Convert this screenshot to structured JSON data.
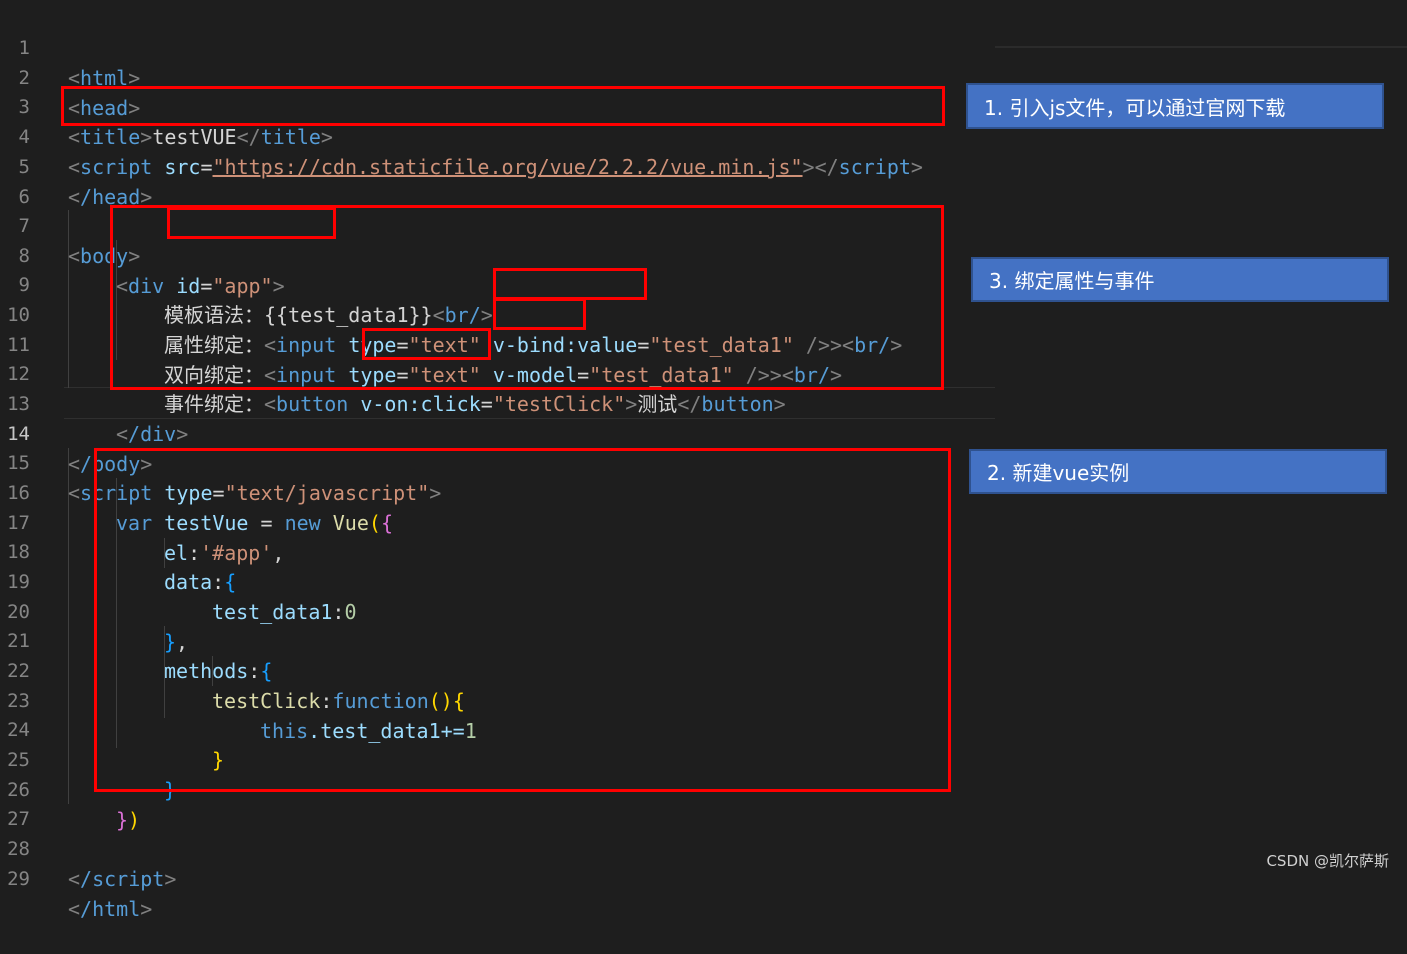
{
  "lines": [
    {
      "n": "1"
    },
    {
      "n": "2"
    },
    {
      "n": "3"
    },
    {
      "n": "4"
    },
    {
      "n": "5"
    },
    {
      "n": "6"
    },
    {
      "n": "7"
    },
    {
      "n": "8"
    },
    {
      "n": "9"
    },
    {
      "n": "10"
    },
    {
      "n": "11"
    },
    {
      "n": "12"
    },
    {
      "n": "13"
    },
    {
      "n": "14"
    },
    {
      "n": "15"
    },
    {
      "n": "16"
    },
    {
      "n": "17"
    },
    {
      "n": "18"
    },
    {
      "n": "19"
    },
    {
      "n": "20"
    },
    {
      "n": "21"
    },
    {
      "n": "22"
    },
    {
      "n": "23"
    },
    {
      "n": "24"
    },
    {
      "n": "25"
    },
    {
      "n": "26"
    },
    {
      "n": "27"
    },
    {
      "n": "28"
    },
    {
      "n": "29"
    }
  ],
  "code": {
    "l1": {
      "tag": "html"
    },
    "l2": {
      "tag": "head"
    },
    "l3": {
      "tag": "title",
      "text": "testVUE",
      "close": "title"
    },
    "l4": {
      "tag": "script",
      "attr": "src",
      "eq": "=",
      "val": "\"https://cdn.staticfile.org/vue/2.2.2/vue.min.js\"",
      "close": "script"
    },
    "l5": {
      "tag": "/head"
    },
    "l7": {
      "tag": "body"
    },
    "l8": {
      "tag": "div",
      "attr": "id",
      "eq": "=",
      "val": "\"app\""
    },
    "l9": {
      "label": "模板语法：",
      "expr": "{{test_data1}}",
      "br": "br/"
    },
    "l10": {
      "label": "属性绑定：",
      "tag": "input",
      "attr1": "type",
      "val1": "\"text\"",
      "attr2": "v-bind:value",
      "val2": "\"test_data1\"",
      "end": " />",
      "br": "br/"
    },
    "l11": {
      "label": "双向绑定：",
      "tag": "input",
      "attr1": "type",
      "val1": "\"text\"",
      "attr2": "v-model",
      "val2": "\"test_data1\"",
      "end": " />",
      "br": "br/"
    },
    "l12": {
      "label": "事件绑定：",
      "tag": "button",
      "attr": "v-on:click",
      "val": "\"testClick\"",
      "text": "测试",
      "close": "button"
    },
    "l13": {
      "tag": "/div"
    },
    "l14": {
      "tag": "/body"
    },
    "l15": {
      "tag": "script",
      "attr": "type",
      "val": "\"text/javascript\""
    },
    "l16": {
      "kw": "var",
      "name": "testVue",
      "op": " = ",
      "kw2": "new",
      "cls": "Vue"
    },
    "l17": {
      "key": "el",
      "val": "'#app'"
    },
    "l18": {
      "key": "data"
    },
    "l19": {
      "key": "test_data1",
      "val": "0"
    },
    "l21": {
      "key": "methods"
    },
    "l22": {
      "key": "testClick",
      "kw": "function"
    },
    "l23": {
      "kw": "this",
      "rest": ".test_data1+=",
      "num": "1"
    },
    "l28": {
      "tag": "/script"
    },
    "l29": {
      "tag": "/html"
    }
  },
  "callouts": {
    "c1": "1. 引入js文件，可以通过官网下载",
    "c2": "2. 新建vue实例",
    "c3": "3. 绑定属性与事件"
  },
  "watermark": "CSDN @凯尔萨斯",
  "colors": {
    "callout_bg": "#4472c4",
    "highlight_border": "#ff0000",
    "editor_bg": "#1e1e1e"
  }
}
